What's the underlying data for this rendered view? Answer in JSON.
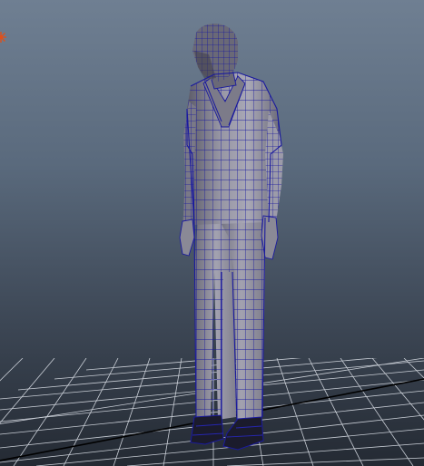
{
  "viewport": {
    "background_top": "#6f7f92",
    "background_bottom": "#242a33",
    "grid_color": "#c9ced6",
    "grid_axis_color": "#000000",
    "wire_color": "#1a1a9e",
    "model_shade": "#8b8a97",
    "model_highlight": "#b3b2bf",
    "model_dark": "#4c4b58",
    "light_icon": "light-icon",
    "light_color": "#e0501a"
  }
}
